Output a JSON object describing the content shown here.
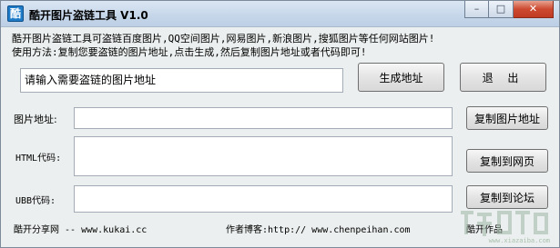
{
  "window": {
    "title": "酷开图片盗链工具 V1.0",
    "app_icon_glyph": "酷",
    "controls": {
      "minimize": "–",
      "maximize": "□",
      "close": "✕"
    }
  },
  "description": {
    "line1": "酷开图片盗链工具可盗链百度图片,QQ空间图片,网易图片,新浪图片,搜狐图片等任何网站图片!",
    "line2": "使用方法:复制您要盗链的图片地址,点击生成,然后复制图片地址或者代码即可!"
  },
  "source_input": {
    "value": "请输入需要盗链的图片地址"
  },
  "buttons": {
    "generate": "生成地址",
    "exit": "退 出",
    "copy_image_url": "复制图片地址",
    "copy_to_web": "复制到网页",
    "copy_to_forum": "复制到论坛"
  },
  "fields": {
    "image_url_label": "图片地址:",
    "html_code_label": "HTML代码:",
    "ubb_code_label": "UBB代码:",
    "image_url_value": "",
    "html_code_value": "",
    "ubb_code_value": ""
  },
  "footer": {
    "site": "酷开分享网 -- www.kukai.cc",
    "blog": "作者博客:http:// www.chenpeihan.com",
    "product": "酷开作品"
  },
  "watermark": {
    "text": "下载吧",
    "url": "www.xiazaiba.com"
  }
}
